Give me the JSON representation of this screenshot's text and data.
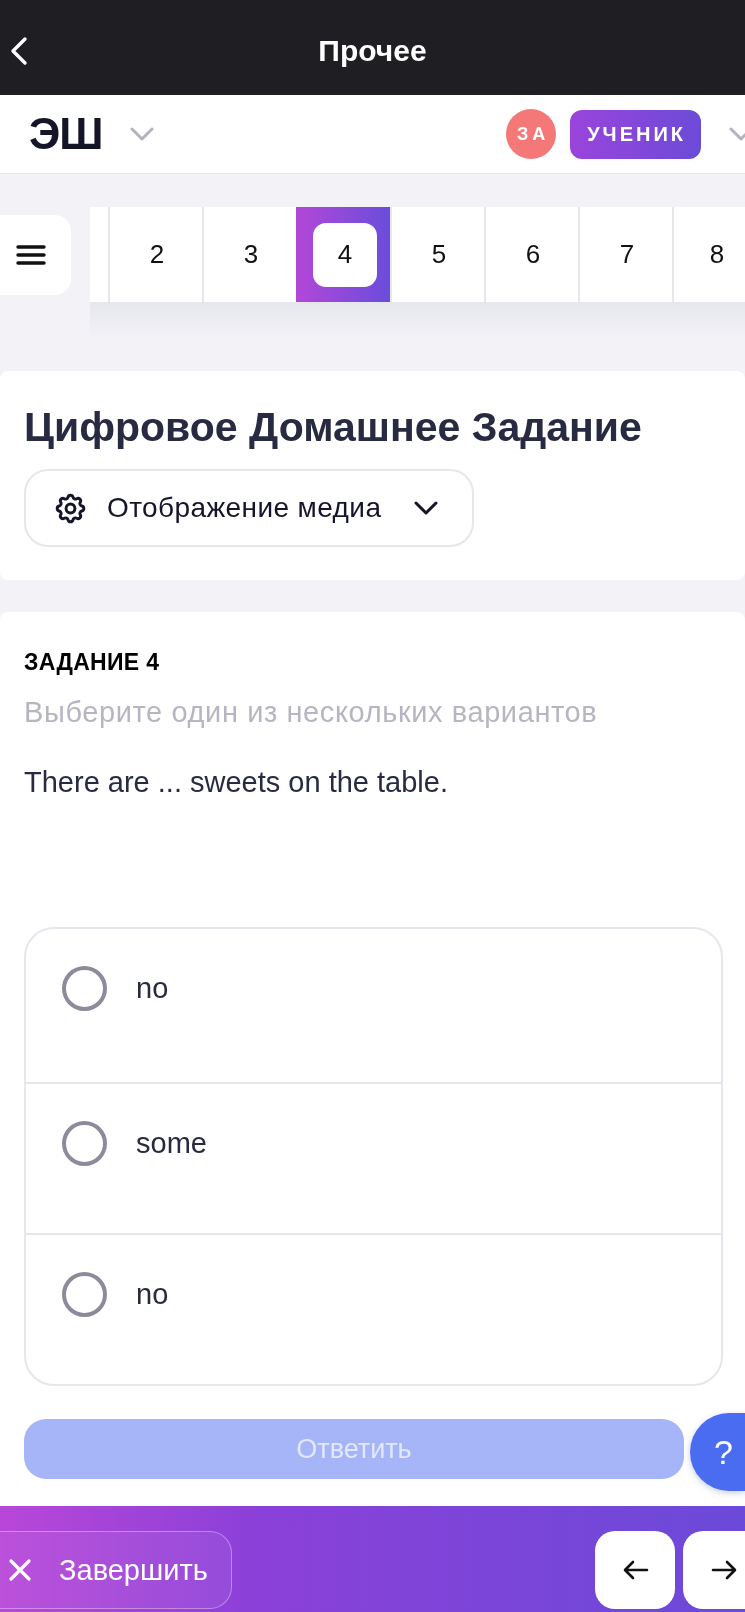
{
  "top_bar": {
    "title": "Прочее"
  },
  "header": {
    "logo": "ЭШ",
    "avatar_initials": "ЗА",
    "role_badge": "УЧЕНИК"
  },
  "question_nav": {
    "items": [
      {
        "label": "2",
        "selected": false
      },
      {
        "label": "3",
        "selected": false
      },
      {
        "label": "4",
        "selected": true
      },
      {
        "label": "5",
        "selected": false
      },
      {
        "label": "6",
        "selected": false
      },
      {
        "label": "7",
        "selected": false
      },
      {
        "label": "8",
        "selected": false
      }
    ]
  },
  "assignment": {
    "title": "Цифровое Домашнее Задание",
    "media_dropdown": {
      "label": "Отображение медиа"
    }
  },
  "task": {
    "heading": "ЗАДАНИЕ 4",
    "instruction": "Выберите один из нескольких вариантов",
    "question": "There are ... sweets on the table.",
    "options": [
      {
        "label": "no",
        "selected": false
      },
      {
        "label": "some",
        "selected": false
      },
      {
        "label": "no",
        "selected": false
      }
    ],
    "submit_button": {
      "label": "Ответить",
      "disabled": true
    }
  },
  "help_button": {
    "label": "?"
  },
  "bottom_bar": {
    "finish_button": {
      "label": "Завершить"
    }
  }
}
